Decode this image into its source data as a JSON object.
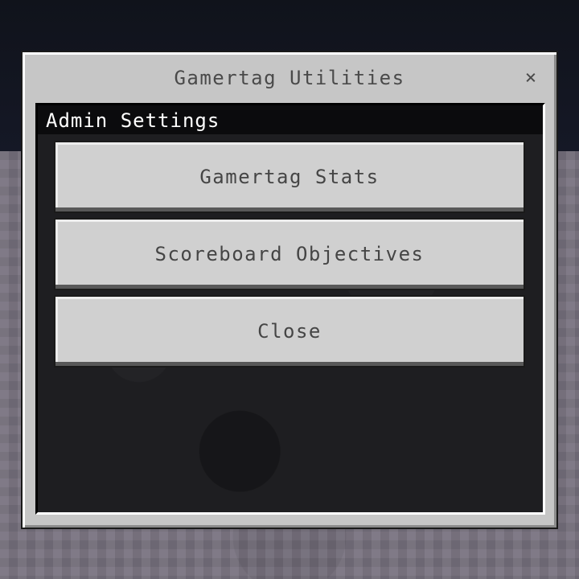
{
  "dialog": {
    "title": "Gamertag Utilities",
    "close_glyph": "×"
  },
  "panel": {
    "header": "Admin Settings",
    "buttons": [
      {
        "label": "Gamertag Stats"
      },
      {
        "label": "Scoreboard Objectives"
      },
      {
        "label": "Close"
      }
    ]
  },
  "colors": {
    "dialog_bg": "#c6c6c6",
    "panel_bg": "#1e1e21",
    "button_bg": "#d0d0d0",
    "button_text": "#454545",
    "header_text": "#ffffff"
  }
}
